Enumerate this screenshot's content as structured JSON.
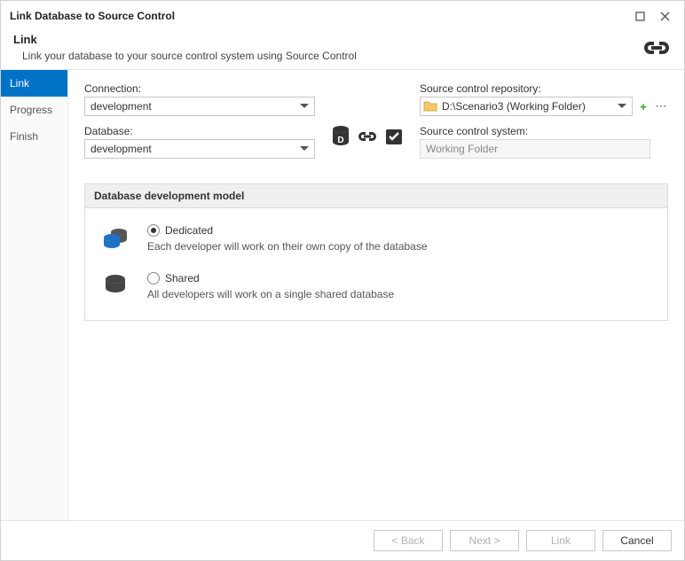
{
  "window": {
    "title": "Link Database to Source Control"
  },
  "header": {
    "heading": "Link",
    "sub": "Link your database to your source control system using Source Control"
  },
  "sidebar": {
    "items": [
      "Link",
      "Progress",
      "Finish"
    ],
    "activeIndex": 0
  },
  "form": {
    "connectionLabel": "Connection:",
    "connectionValue": "development",
    "databaseLabel": "Database:",
    "databaseValue": "development",
    "repoLabel": "Source control repository:",
    "repoValue": "D:\\Scenario3 (Working Folder)",
    "systemLabel": "Source control system:",
    "systemValue": "Working Folder"
  },
  "panel": {
    "title": "Database development model",
    "dedicated": {
      "label": "Dedicated",
      "desc": "Each developer will work on their own copy of the database",
      "selected": true
    },
    "shared": {
      "label": "Shared",
      "desc": "All developers will work on a single shared database",
      "selected": false
    }
  },
  "footer": {
    "back": "< Back",
    "next": "Next >",
    "link": "Link",
    "cancel": "Cancel"
  }
}
